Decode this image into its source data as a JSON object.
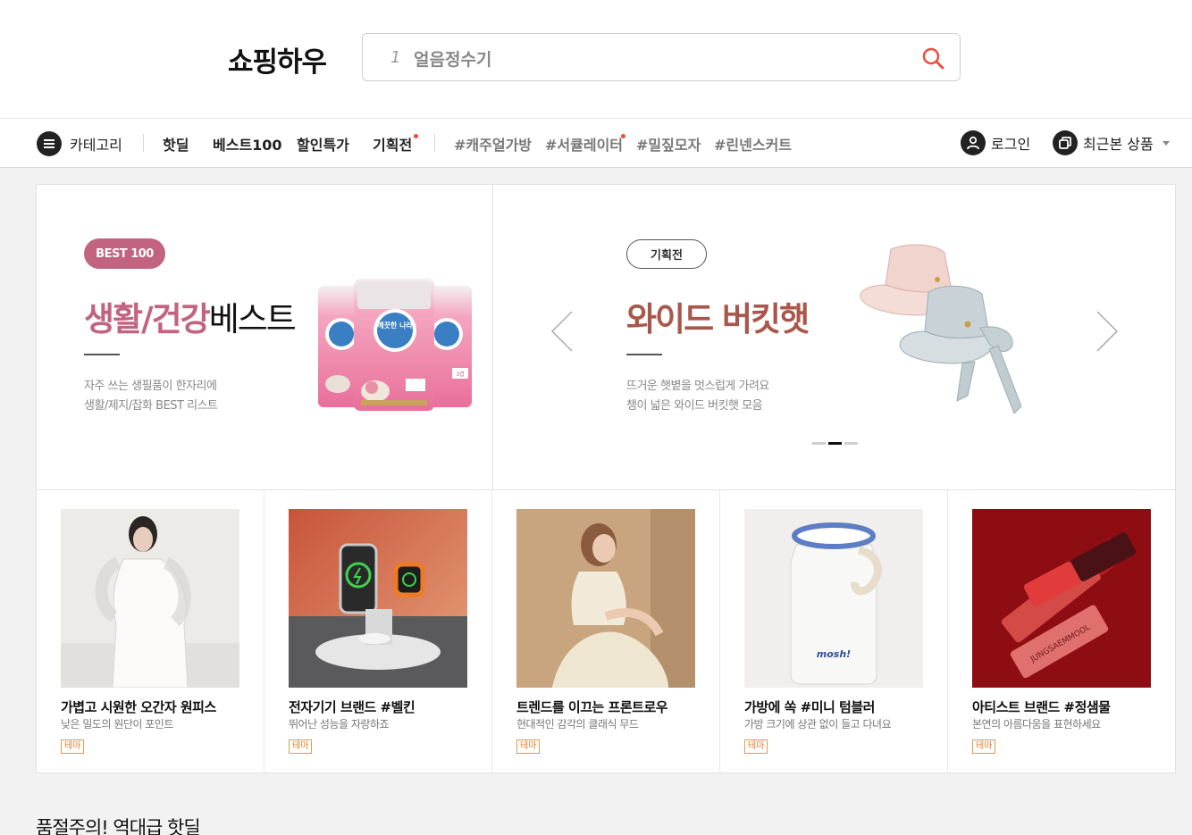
{
  "header": {
    "logo": "쇼핑하우",
    "search": {
      "rank": "1",
      "keyword": "얼음정수기"
    }
  },
  "nav": {
    "category_label": "카테고리",
    "links": [
      "핫딜",
      "베스트100",
      "할인특가",
      "기획전"
    ],
    "tags": [
      "#캐주얼가방",
      "#서큘레이터",
      "#밀짚모자",
      "#린넨스커트"
    ],
    "login_label": "로그인",
    "recent_label": "최근본 상품"
  },
  "banners": {
    "left": {
      "badge": "BEST 100",
      "title_accent": "생활/건강",
      "title_plain": "베스트",
      "desc_line1": "자주 쓰는 생필품이 한자리에",
      "desc_line2": "생활/제지/잡화 BEST 리스트",
      "product_brand": "깨끗한 나라",
      "product_count": "3겹"
    },
    "right": {
      "badge": "기획전",
      "title": "와이드 버킷햇",
      "desc_line1": "뜨거운 햇볕을 멋스럽게 가려요",
      "desc_line2": "챙이 넓은 와이드 버킷햇 모음"
    },
    "active_slide": 2,
    "slide_count": 3
  },
  "themes": [
    {
      "title": "가볍고 시원한 오간자 원피스",
      "subtitle": "낮은 밀도의 원단이 포인트",
      "tag": "테마"
    },
    {
      "title": "전자기기 브랜드 #벨킨",
      "subtitle": "뛰어난 성능을 자랑하죠",
      "tag": "테마"
    },
    {
      "title": "트렌드를 이끄는 프론트로우",
      "subtitle": "현대적인 감각의 클래식 무드",
      "tag": "테마"
    },
    {
      "title": "가방에 쏙 #미니 텀블러",
      "subtitle": "가방 크기에 상관 없이 들고 다녀요",
      "tag": "테마",
      "product_text": "mosh!"
    },
    {
      "title": "아티스트 브랜드 #정샘물",
      "subtitle": "본연의 아름다움을 표현하세요",
      "tag": "테마",
      "product_text": "JUNGSAEMMOOL"
    }
  ],
  "section": {
    "title": "품절주의! 역대급 핫딜"
  },
  "colors": {
    "accent_red": "#ee4b3c",
    "best_pink": "#c2637f",
    "plan_brown": "#a9574b",
    "tag_orange": "#e07f26"
  }
}
